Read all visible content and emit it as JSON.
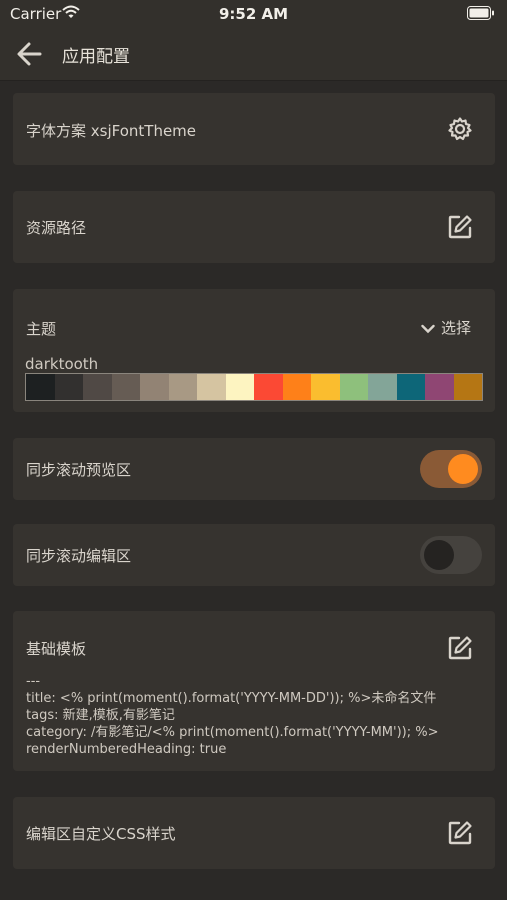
{
  "status_bar": {
    "carrier": "Carrier",
    "time": "9:52 AM"
  },
  "header": {
    "title": "应用配置"
  },
  "font_scheme": {
    "label": "字体方案 xsjFontTheme"
  },
  "resource_path": {
    "label": "资源路径"
  },
  "theme": {
    "label": "主题",
    "select_label": "选择",
    "current_theme": "darktooth",
    "swatches": [
      "#1d2021",
      "#32302f",
      "#504945",
      "#665c54",
      "#928374",
      "#a89984",
      "#d5c4a1",
      "#fdf4c1",
      "#fb4934",
      "#fe8019",
      "#fabd2f",
      "#8ec07c",
      "#83a598",
      "#0d6678",
      "#8f4673",
      "#b57614"
    ]
  },
  "sync_preview": {
    "label": "同步滚动预览区",
    "enabled": true
  },
  "sync_editor": {
    "label": "同步滚动编辑区",
    "enabled": false
  },
  "base_template": {
    "label": "基础模板",
    "content": "---\ntitle: <% print(moment().format('YYYY-MM-DD')); %>未命名文件\ntags: 新建,模板,有影笔记\ncategory: /有影笔记/<% print(moment().format('YYYY-MM')); %>\nrenderNumberedHeading: true"
  },
  "custom_css": {
    "label": "编辑区自定义CSS样式"
  },
  "colors": {
    "background": "#2b2927",
    "card": "#36332f",
    "accent": "#ff8b1f"
  }
}
